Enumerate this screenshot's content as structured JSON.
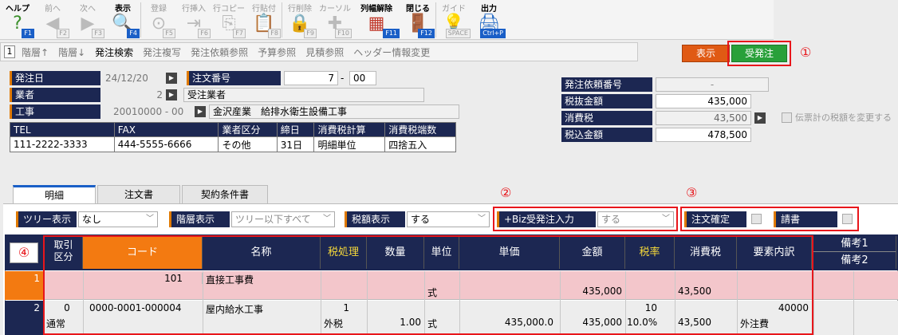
{
  "toolbar": [
    {
      "label": "ヘルプ",
      "key": "F1",
      "icon": "help-icon",
      "glyph": "?",
      "on": true
    },
    {
      "label": "前へ",
      "key": "F2",
      "icon": "arrow-left-icon",
      "glyph": "◀",
      "on": false
    },
    {
      "label": "次へ",
      "key": "F3",
      "icon": "arrow-right-icon",
      "glyph": "▶",
      "on": false
    },
    {
      "label": "表示",
      "key": "F4",
      "icon": "magnifier-icon",
      "glyph": "🔍",
      "on": true
    },
    {
      "label": "登録",
      "key": "F5",
      "icon": "ok-icon",
      "glyph": "⊙",
      "on": false
    },
    {
      "label": "行挿入",
      "key": "F6",
      "icon": "row-insert-icon",
      "glyph": "⇥",
      "on": false
    },
    {
      "label": "行コピー",
      "key": "F7",
      "icon": "row-copy-icon",
      "glyph": "⎘",
      "on": false
    },
    {
      "label": "行貼付",
      "key": "F8",
      "icon": "row-paste-icon",
      "glyph": "📋",
      "on": false
    },
    {
      "label": "行削除",
      "key": "F9",
      "icon": "row-delete-icon",
      "glyph": "🔒",
      "on": false
    },
    {
      "label": "カーソル",
      "key": "F10",
      "icon": "cursor-icon",
      "glyph": "✚",
      "on": false
    },
    {
      "label": "列幅解除",
      "key": "F11",
      "icon": "column-width-icon",
      "glyph": "▦",
      "on": true
    },
    {
      "label": "閉じる",
      "key": "F12",
      "icon": "door-icon",
      "glyph": "🚪",
      "on": true
    },
    {
      "label": "ガイド",
      "key": "SPACE",
      "icon": "bulb-icon",
      "glyph": "💡",
      "on": false
    },
    {
      "label": "出力",
      "key": "Ctrl+P",
      "icon": "printer-icon",
      "glyph": "🖨",
      "on": true
    }
  ],
  "subbar": {
    "num": "1",
    "items": [
      "階層↑",
      "階層↓",
      "発注検索",
      "発注複写",
      "発注依頼参照",
      "予算参照",
      "見積参照",
      "ヘッダー情報変更"
    ]
  },
  "buttons": {
    "show": "表示",
    "order": "受発注"
  },
  "markers": [
    "①",
    "②",
    "③",
    "④"
  ],
  "form": {
    "order_date_label": "発注日",
    "order_date": "24/12/20",
    "order_no_label": "注文番号",
    "order_no": "7",
    "order_no_sep": "-",
    "order_no_branch": "00",
    "vendor_label": "業者",
    "vendor_code": "2",
    "vendor_name": "受注業者",
    "project_label": "工事",
    "project_code": "20010000 - 00",
    "project_name": "金沢産業　給排水衛生設備工事"
  },
  "vendor_table": {
    "headers": [
      "TEL",
      "FAX",
      "業者区分",
      "締日",
      "消費税計算",
      "消費税端数"
    ],
    "row": [
      "111-2222-3333",
      "444-5555-6666",
      "その他",
      "31日",
      "明細単位",
      "四捨五入"
    ]
  },
  "totals": {
    "request_no_label": "発注依頼番号",
    "request_no": "-",
    "subtotal_label": "税抜金額",
    "subtotal": "435,000",
    "tax_label": "消費税",
    "tax": "43,500",
    "total_label": "税込金額",
    "total": "478,500",
    "change_tax_label": "伝票計の税額を変更する"
  },
  "tabs": [
    "明細",
    "注文書",
    "契約条件書"
  ],
  "grid_opts": {
    "tree_label": "ツリー表示",
    "tree_value": "なし",
    "level_label": "階層表示",
    "level_value": "ツリー以下すべて",
    "taxshow_label": "税額表示",
    "taxshow_value": "する",
    "biz_label": "+Biz受発注入力",
    "biz_value": "する",
    "confirm_label": "注文確定",
    "invoice_label": "請書"
  },
  "grid": {
    "headers": [
      "取引\n区分",
      "コード",
      "名称",
      "税処理",
      "数量",
      "単位",
      "単価",
      "金額",
      "税率",
      "消費税",
      "要素内訳",
      "備考1",
      "備考2"
    ],
    "rows": [
      {
        "no": "1",
        "kbn": "",
        "kbn2": "",
        "code": "101",
        "name": "直接工事費",
        "taxp": "",
        "taxp2": "",
        "qty": "",
        "unit": "式",
        "price": "",
        "amount": "435,000",
        "rate": "",
        "rate2": "",
        "tax": "43,500",
        "elem": "",
        "elem2": ""
      },
      {
        "no": "2",
        "kbn": "0",
        "kbn2": "通常",
        "code": "0000-0001-000004",
        "name": "屋内給水工事",
        "taxp": "1",
        "taxp2": "外税",
        "qty": "1.00",
        "unit": "式",
        "price": "435,000.0",
        "amount": "435,000",
        "rate": "10",
        "rate2": "10.0%",
        "tax": "43,500",
        "elem": "40000",
        "elem2": "外注費"
      }
    ]
  }
}
